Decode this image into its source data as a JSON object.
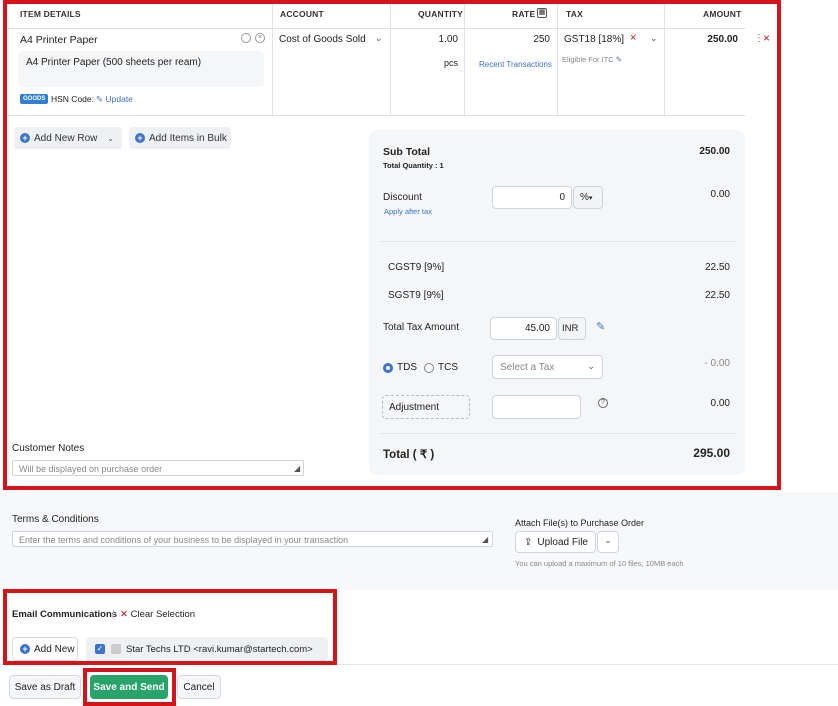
{
  "table": {
    "headers": {
      "item_details": "ITEM DETAILS",
      "account": "ACCOUNT",
      "quantity": "QUANTITY",
      "rate": "RATE",
      "tax": "TAX",
      "amount": "AMOUNT"
    },
    "row": {
      "item_name": "A4 Printer Paper",
      "item_description": "A4 Printer Paper (500 sheets per ream)",
      "goods_badge": "GOODS",
      "hsn_label": "HSN Code:",
      "hsn_update": "Update",
      "account": "Cost of Goods Sold",
      "quantity": "1.00",
      "unit": "pcs",
      "rate": "250",
      "recent_transactions": "Recent Transactions",
      "tax": "GST18 [18%]",
      "eligible_itc": "Eligible For ITC",
      "amount": "250.00"
    }
  },
  "actions": {
    "add_new_row": "Add New Row",
    "add_items_bulk": "Add Items in Bulk"
  },
  "summary": {
    "sub_total_label": "Sub Total",
    "sub_total": "250.00",
    "total_quantity": "Total Quantity : 1",
    "discount_label": "Discount",
    "apply_after_tax": "Apply after tax",
    "discount_value": "0",
    "discount_unit": "%",
    "discount_amount": "0.00",
    "cgst_label": "CGST9 [9%]",
    "cgst_value": "22.50",
    "sgst_label": "SGST9 [9%]",
    "sgst_value": "22.50",
    "total_tax_label": "Total Tax Amount",
    "total_tax_value": "45.00",
    "total_tax_currency": "INR",
    "tds_label": "TDS",
    "tcs_label": "TCS",
    "select_tax_placeholder": "Select a Tax",
    "tds_amount": "- 0.00",
    "adjustment_label": "Adjustment",
    "adjustment_amount": "0.00",
    "total_label": "Total ( ₹ )",
    "total_value": "295.00"
  },
  "customer_notes": {
    "label": "Customer Notes",
    "placeholder": "Will be displayed on purchase order"
  },
  "terms": {
    "label": "Terms & Conditions",
    "placeholder": "Enter the terms and conditions of your business to be displayed in your transaction"
  },
  "attach": {
    "label": "Attach File(s) to Purchase Order",
    "upload": "Upload File",
    "hint": "You can upload a maximum of 10 files, 10MB each"
  },
  "email": {
    "label": "Email Communications",
    "clear": "Clear Selection",
    "add_new": "Add New",
    "contact": "Star Techs LTD <ravi.kumar@startech.com>"
  },
  "footer": {
    "save_draft": "Save as Draft",
    "save_send": "Save and Send",
    "cancel": "Cancel"
  },
  "colors": {
    "highlight_red": "#d4141a",
    "primary_green": "#28a36a",
    "link_blue": "#3b74c8"
  }
}
